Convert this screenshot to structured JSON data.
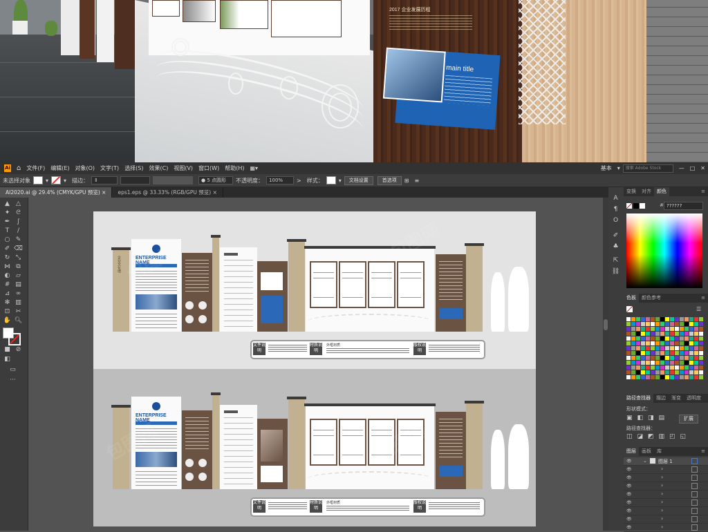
{
  "render": {
    "year_tag": "2017 企业发展历程",
    "blue_panel_title": "main title"
  },
  "menubar": {
    "items": [
      "文件(F)",
      "编辑(E)",
      "对象(O)",
      "文字(T)",
      "选择(S)",
      "效果(C)",
      "视图(V)",
      "窗口(W)",
      "帮助(H)"
    ],
    "workspace": "基本",
    "search_placeholder": "搜索 Adobe Stock"
  },
  "controlbar": {
    "selection_label": "未选择对象",
    "stroke_label": "描边：",
    "brush_value": "5 点圆形",
    "opacity_label": "不透明度：",
    "opacity_value": "100%",
    "style_label": "样式：",
    "doc_setup": "文档设置",
    "preferences": "首选项"
  },
  "tabs": [
    {
      "label": "AI2020.ai @ 29.4% (CMYK/GPU 预览)",
      "active": true
    },
    {
      "label": "eps1.eps @ 33.33% (RGB/GPU 预览)",
      "active": false
    }
  ],
  "artboard": {
    "enterprise_name": "ENTERPRISE NAME",
    "caption_labels": [
      "文件说明",
      "材质说明",
      "版权说明"
    ],
    "center_caption": "外框材质"
  },
  "panels": {
    "top_tabs": [
      "变换",
      "对齐",
      "颜色"
    ],
    "hex_value": "??????",
    "swatch_tabs": [
      "色板",
      "颜色参考"
    ],
    "pathfinder_tabs": [
      "路径查找器",
      "描边",
      "渐变",
      "透明度"
    ],
    "shape_mode_label": "形状模式：",
    "pathfinder_label": "路径查找器：",
    "expand_button": "扩展",
    "layers_tabs": [
      "图层",
      "画板",
      "库"
    ],
    "layer_name": "图层 1"
  },
  "colors": {
    "accent_blue": "#1f63b4",
    "brown": "#6b5344",
    "tan": "#c1b191"
  }
}
